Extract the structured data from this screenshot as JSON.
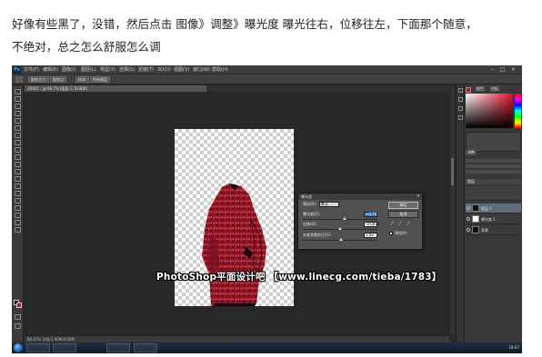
{
  "caption": {
    "line1": "好像有些黑了，没错，然后点击 图像》调整》曝光度 曝光往右，位移往左，下面那个随意，",
    "line2": "不绝对，总之怎么舒服怎么调"
  },
  "app": {
    "logo": "Ps",
    "menu": [
      "文件(F)",
      "编辑(E)",
      "图像(I)",
      "图层(L)",
      "类型(Y)",
      "选择(S)",
      "滤镜(T)",
      "3D(D)",
      "视图(V)",
      "窗口(W)",
      "帮助(H)"
    ],
    "options": [
      "取样大小:",
      "取样点",
      "样本:",
      "所有图层"
    ],
    "doc_tab": "20061…@ 66.7% (图层 1, RGB/8)",
    "status": "66.67%   文档:1.40M/4.00M"
  },
  "panels": {
    "tabs": [
      "颜色",
      "色板"
    ],
    "adjust_tab": "调整",
    "layers_tab": "图层",
    "layers": [
      {
        "name": "图层 1",
        "selected": true,
        "thumb": "dark"
      },
      {
        "name": "曝光度 1",
        "selected": false,
        "thumb": "light"
      },
      {
        "name": "背景",
        "selected": false,
        "thumb": "dark"
      }
    ]
  },
  "dialog": {
    "title": "曝光度",
    "preset_label": "预设(R):",
    "preset_value": "默认",
    "exposure_label": "曝光度(E):",
    "exposure_value": "+0.74",
    "offset_label": "位移(O):",
    "offset_value": "-0.0073",
    "gamma_label": "灰度系数校正(G):",
    "gamma_value": "1.02",
    "ok_label": "确定",
    "cancel_label": "取消",
    "preview_label": "预览(P)"
  },
  "taskbar": {
    "buttons": [
      "",
      "",
      "",
      ""
    ],
    "clock": "18:07"
  },
  "watermark": "PhotoShop平面设计吧 【www.linecg.com/tieba/1783】",
  "colors": {
    "background": "#282828",
    "accent_red": "#c8102e",
    "selection_blue": "#3a78c8"
  }
}
